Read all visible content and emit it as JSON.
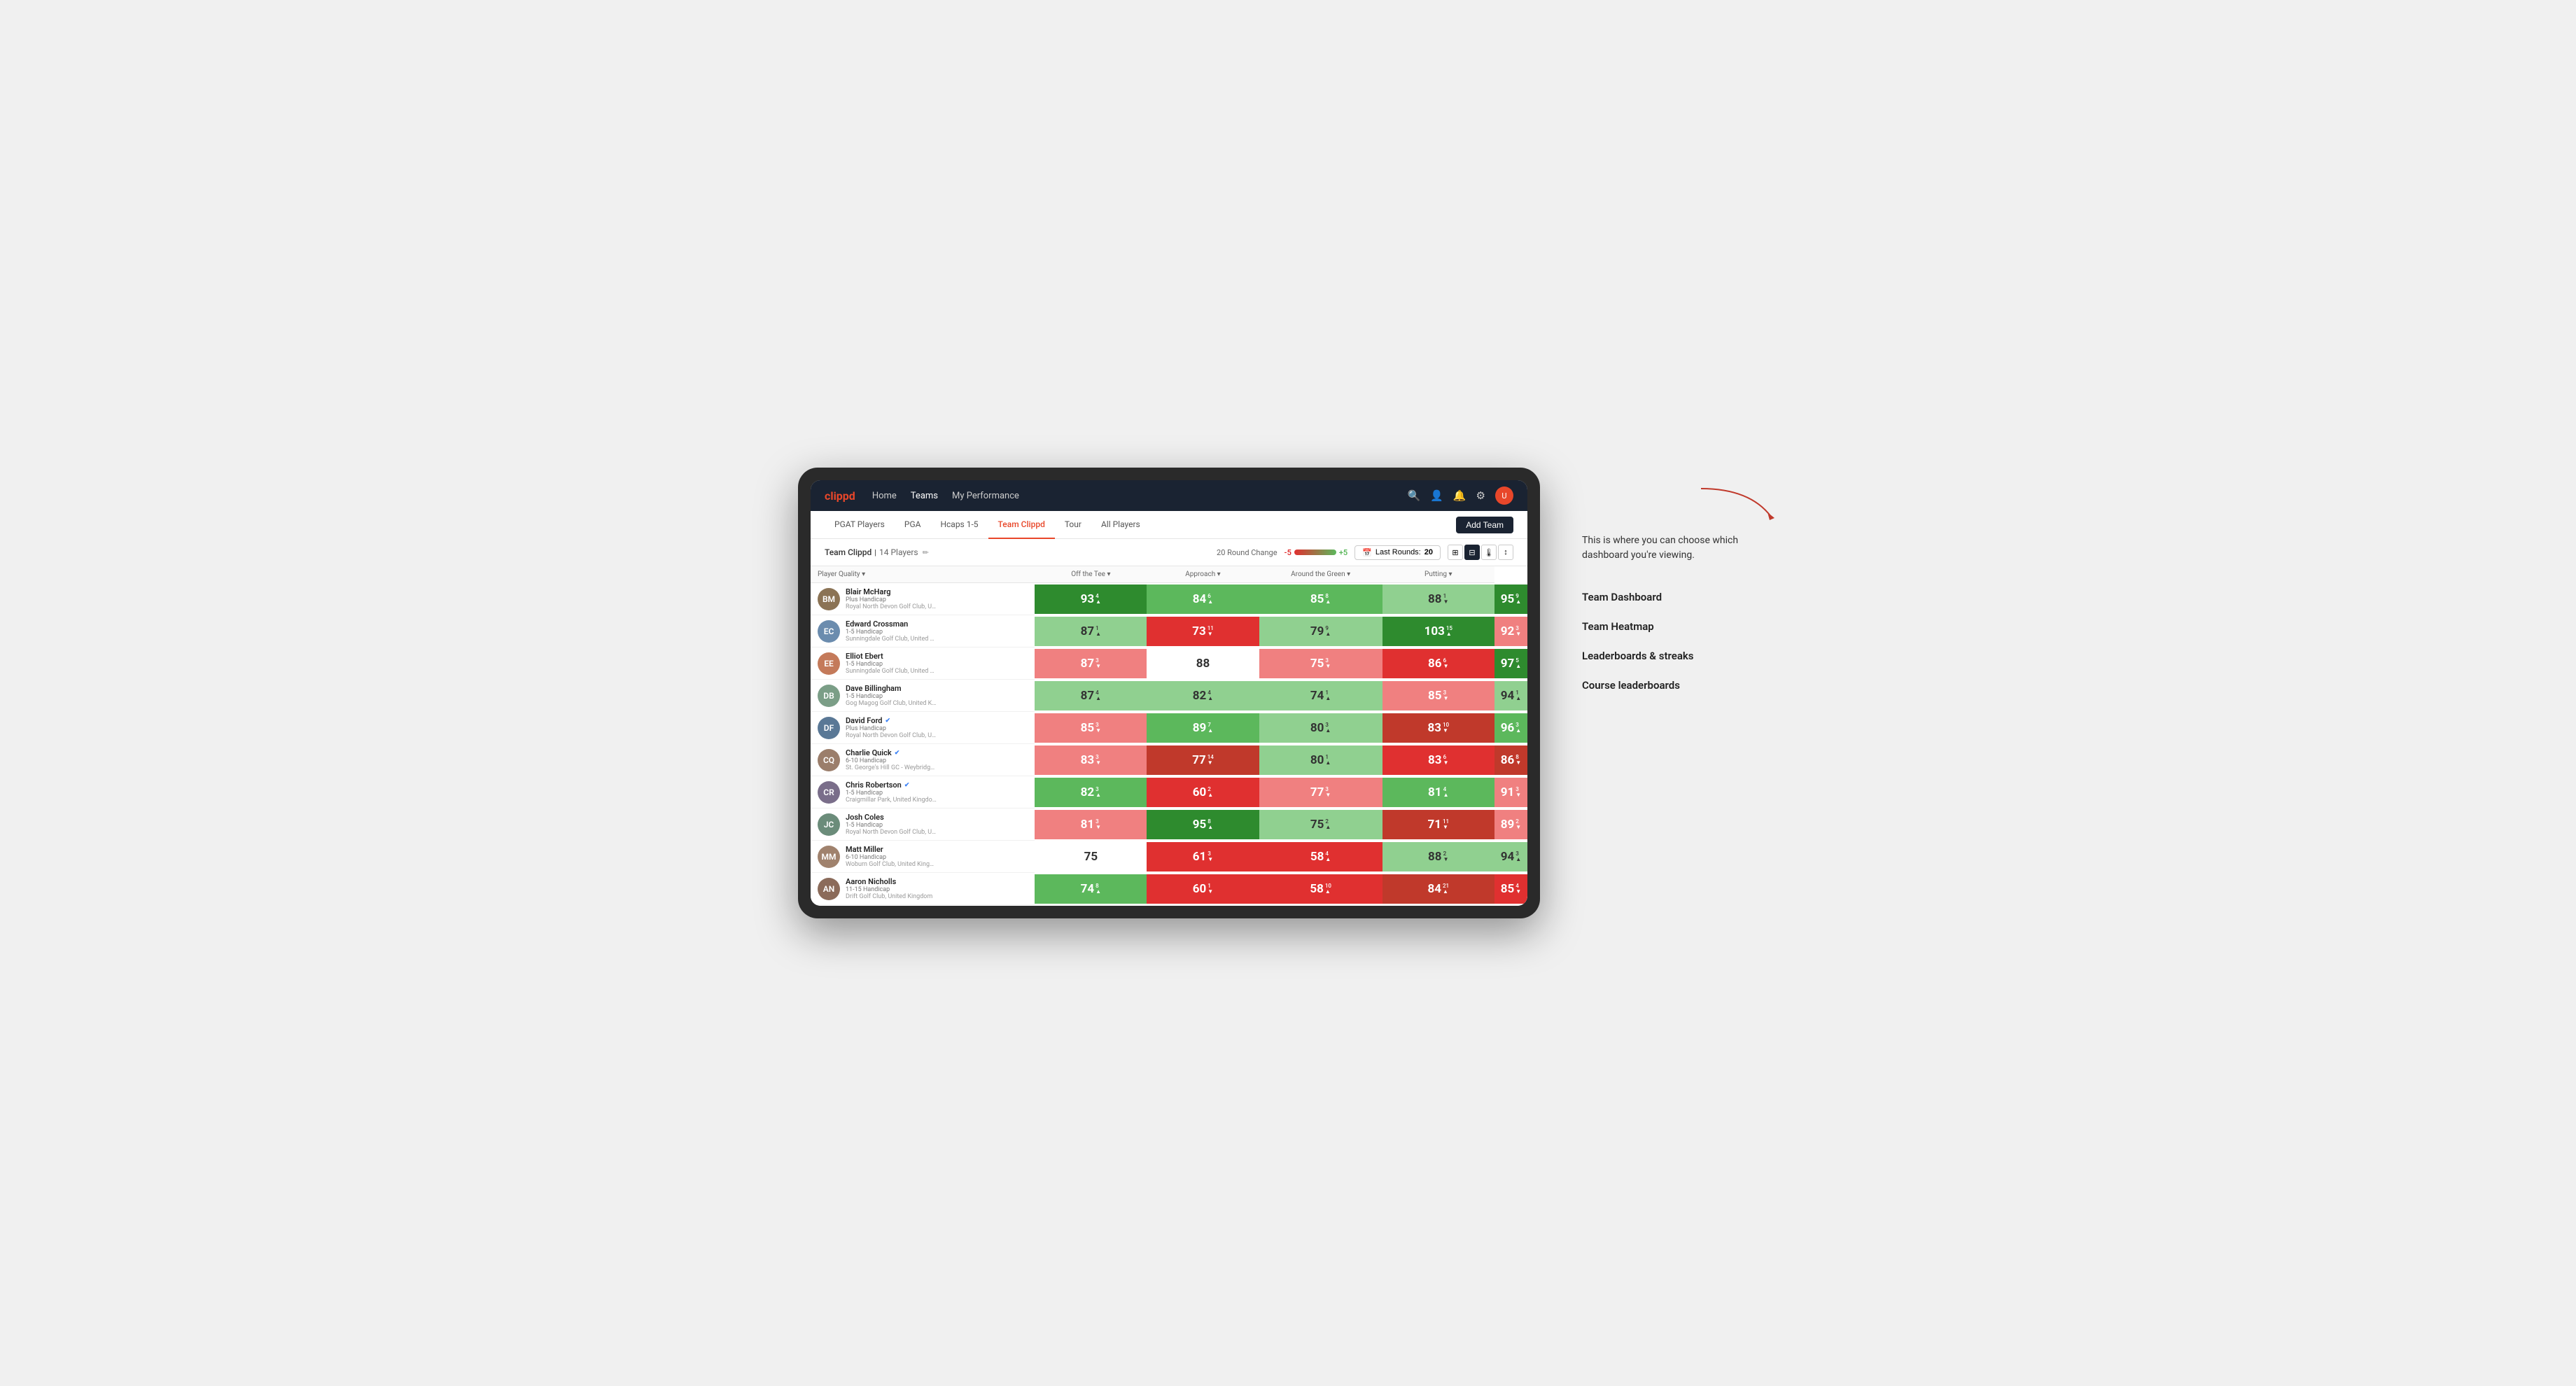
{
  "app": {
    "logo": "clippd",
    "nav": {
      "links": [
        "Home",
        "Teams",
        "My Performance"
      ],
      "active": "Teams",
      "icons": [
        "search",
        "person",
        "bell",
        "settings",
        "avatar"
      ]
    },
    "sub_nav": {
      "links": [
        "PGAT Players",
        "PGA",
        "Hcaps 1-5",
        "Team Clippd",
        "Tour",
        "All Players"
      ],
      "active": "Team Clippd",
      "add_team_label": "Add Team"
    }
  },
  "team_header": {
    "name": "Team Clippd",
    "count": "14 Players",
    "round_change_label": "20 Round Change",
    "scale_neg": "-5",
    "scale_pos": "+5",
    "last_rounds_label": "Last Rounds:",
    "last_rounds_value": "20",
    "view_icons": [
      "grid-small",
      "grid-large",
      "heatmap",
      "sort"
    ]
  },
  "table": {
    "col_headers": [
      {
        "label": "Player Quality ▾",
        "key": "quality"
      },
      {
        "label": "Off the Tee ▾",
        "key": "tee"
      },
      {
        "label": "Approach ▾",
        "key": "approach"
      },
      {
        "label": "Around the Green ▾",
        "key": "green"
      },
      {
        "label": "Putting ▾",
        "key": "putting"
      }
    ],
    "players": [
      {
        "name": "Blair McHarg",
        "handicap": "Plus Handicap",
        "club": "Royal North Devon Golf Club, United Kingdom",
        "verified": false,
        "avatar_color": "#8B7355",
        "initials": "BM",
        "quality": {
          "score": 93,
          "change": 4,
          "dir": "up",
          "color": "green-dark"
        },
        "tee": {
          "score": 84,
          "change": 6,
          "dir": "up",
          "color": "green-mid"
        },
        "approach": {
          "score": 85,
          "change": 8,
          "dir": "up",
          "color": "green-mid"
        },
        "green": {
          "score": 88,
          "change": 1,
          "dir": "down",
          "color": "green-light"
        },
        "putting": {
          "score": 95,
          "change": 9,
          "dir": "up",
          "color": "green-dark"
        }
      },
      {
        "name": "Edward Crossman",
        "handicap": "1-5 Handicap",
        "club": "Sunningdale Golf Club, United Kingdom",
        "verified": false,
        "avatar_color": "#6B8CAE",
        "initials": "EC",
        "quality": {
          "score": 87,
          "change": 1,
          "dir": "up",
          "color": "green-light"
        },
        "tee": {
          "score": 73,
          "change": 11,
          "dir": "down",
          "color": "red-mid"
        },
        "approach": {
          "score": 79,
          "change": 9,
          "dir": "up",
          "color": "green-light"
        },
        "green": {
          "score": 103,
          "change": 15,
          "dir": "up",
          "color": "green-dark"
        },
        "putting": {
          "score": 92,
          "change": 3,
          "dir": "down",
          "color": "red-light"
        }
      },
      {
        "name": "Elliot Ebert",
        "handicap": "1-5 Handicap",
        "club": "Sunningdale Golf Club, United Kingdom",
        "verified": false,
        "avatar_color": "#C47A5A",
        "initials": "EE",
        "quality": {
          "score": 87,
          "change": 3,
          "dir": "down",
          "color": "red-light"
        },
        "tee": {
          "score": 88,
          "change": 0,
          "dir": "none",
          "color": "white"
        },
        "approach": {
          "score": 75,
          "change": 3,
          "dir": "down",
          "color": "red-light"
        },
        "green": {
          "score": 86,
          "change": 6,
          "dir": "down",
          "color": "red-mid"
        },
        "putting": {
          "score": 97,
          "change": 5,
          "dir": "up",
          "color": "green-dark"
        }
      },
      {
        "name": "Dave Billingham",
        "handicap": "1-5 Handicap",
        "club": "Gog Magog Golf Club, United Kingdom",
        "verified": false,
        "avatar_color": "#7B9E87",
        "initials": "DB",
        "quality": {
          "score": 87,
          "change": 4,
          "dir": "up",
          "color": "green-light"
        },
        "tee": {
          "score": 82,
          "change": 4,
          "dir": "up",
          "color": "green-light"
        },
        "approach": {
          "score": 74,
          "change": 1,
          "dir": "up",
          "color": "green-light"
        },
        "green": {
          "score": 85,
          "change": 3,
          "dir": "down",
          "color": "red-light"
        },
        "putting": {
          "score": 94,
          "change": 1,
          "dir": "up",
          "color": "green-light"
        }
      },
      {
        "name": "David Ford",
        "handicap": "Plus Handicap",
        "club": "Royal North Devon Golf Club, United Kingdom",
        "verified": true,
        "avatar_color": "#5A7896",
        "initials": "DF",
        "quality": {
          "score": 85,
          "change": 3,
          "dir": "down",
          "color": "red-light"
        },
        "tee": {
          "score": 89,
          "change": 7,
          "dir": "up",
          "color": "green-mid"
        },
        "approach": {
          "score": 80,
          "change": 3,
          "dir": "up",
          "color": "green-light"
        },
        "green": {
          "score": 83,
          "change": 10,
          "dir": "down",
          "color": "red-dark"
        },
        "putting": {
          "score": 96,
          "change": 3,
          "dir": "up",
          "color": "green-mid"
        }
      },
      {
        "name": "Charlie Quick",
        "handicap": "6-10 Handicap",
        "club": "St. George's Hill GC - Weybridge - Surrey, Uni...",
        "verified": true,
        "avatar_color": "#9B7E6B",
        "initials": "CQ",
        "quality": {
          "score": 83,
          "change": 3,
          "dir": "down",
          "color": "red-light"
        },
        "tee": {
          "score": 77,
          "change": 14,
          "dir": "down",
          "color": "red-dark"
        },
        "approach": {
          "score": 80,
          "change": 1,
          "dir": "up",
          "color": "green-light"
        },
        "green": {
          "score": 83,
          "change": 6,
          "dir": "down",
          "color": "red-mid"
        },
        "putting": {
          "score": 86,
          "change": 8,
          "dir": "down",
          "color": "red-dark"
        }
      },
      {
        "name": "Chris Robertson",
        "handicap": "1-5 Handicap",
        "club": "Craigmillar Park, United Kingdom",
        "verified": true,
        "avatar_color": "#7A6E8A",
        "initials": "CR",
        "quality": {
          "score": 82,
          "change": 3,
          "dir": "up",
          "color": "green-mid"
        },
        "tee": {
          "score": 60,
          "change": 2,
          "dir": "up",
          "color": "red-mid"
        },
        "approach": {
          "score": 77,
          "change": 3,
          "dir": "down",
          "color": "red-light"
        },
        "green": {
          "score": 81,
          "change": 4,
          "dir": "up",
          "color": "green-mid"
        },
        "putting": {
          "score": 91,
          "change": 3,
          "dir": "down",
          "color": "red-light"
        }
      },
      {
        "name": "Josh Coles",
        "handicap": "1-5 Handicap",
        "club": "Royal North Devon Golf Club, United Kingdom",
        "verified": false,
        "avatar_color": "#6B8C7A",
        "initials": "JC",
        "quality": {
          "score": 81,
          "change": 3,
          "dir": "down",
          "color": "red-light"
        },
        "tee": {
          "score": 95,
          "change": 8,
          "dir": "up",
          "color": "green-dark"
        },
        "approach": {
          "score": 75,
          "change": 2,
          "dir": "up",
          "color": "green-light"
        },
        "green": {
          "score": 71,
          "change": 11,
          "dir": "down",
          "color": "red-dark"
        },
        "putting": {
          "score": 89,
          "change": 2,
          "dir": "down",
          "color": "red-light"
        }
      },
      {
        "name": "Matt Miller",
        "handicap": "6-10 Handicap",
        "club": "Woburn Golf Club, United Kingdom",
        "verified": false,
        "avatar_color": "#A0826D",
        "initials": "MM",
        "quality": {
          "score": 75,
          "change": 0,
          "dir": "none",
          "color": "white"
        },
        "tee": {
          "score": 61,
          "change": 3,
          "dir": "down",
          "color": "red-mid"
        },
        "approach": {
          "score": 58,
          "change": 4,
          "dir": "up",
          "color": "red-mid"
        },
        "green": {
          "score": 88,
          "change": 2,
          "dir": "down",
          "color": "green-light"
        },
        "putting": {
          "score": 94,
          "change": 3,
          "dir": "up",
          "color": "green-light"
        }
      },
      {
        "name": "Aaron Nicholls",
        "handicap": "11-15 Handicap",
        "club": "Drift Golf Club, United Kingdom",
        "verified": false,
        "avatar_color": "#8B6B5A",
        "initials": "AN",
        "quality": {
          "score": 74,
          "change": 8,
          "dir": "up",
          "color": "green-mid"
        },
        "tee": {
          "score": 60,
          "change": 1,
          "dir": "down",
          "color": "red-mid"
        },
        "approach": {
          "score": 58,
          "change": 10,
          "dir": "up",
          "color": "red-mid"
        },
        "green": {
          "score": 84,
          "change": 21,
          "dir": "up",
          "color": "red-dark"
        },
        "putting": {
          "score": 85,
          "change": 4,
          "dir": "down",
          "color": "red-mid"
        }
      }
    ]
  },
  "annotation": {
    "callout": "This is where you can choose which dashboard you're viewing.",
    "items": [
      "Team Dashboard",
      "Team Heatmap",
      "Leaderboards & streaks",
      "Course leaderboards"
    ]
  }
}
